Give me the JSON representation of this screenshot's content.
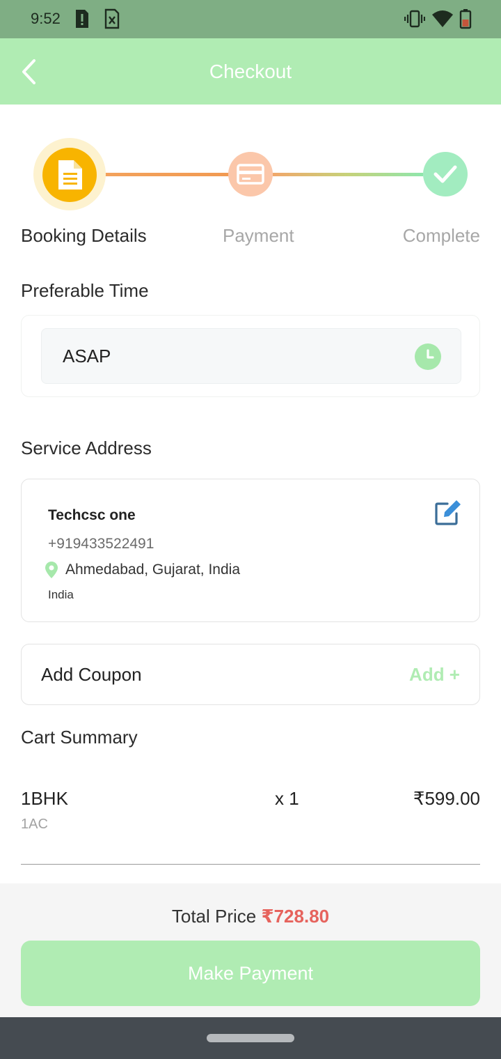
{
  "status_bar": {
    "time": "9:52",
    "icons": [
      "sim-alert-icon",
      "sim-card-icon",
      "vibrate-icon",
      "wifi-icon",
      "battery-icon"
    ]
  },
  "header": {
    "title": "Checkout",
    "back_icon": "chevron-left-icon",
    "background_color": "#b0ecb3"
  },
  "stepper": {
    "steps": [
      {
        "label": "Booking Details",
        "icon": "document-icon",
        "state": "active",
        "color": "#f8b400"
      },
      {
        "label": "Payment",
        "icon": "card-icon",
        "state": "pending",
        "color": "#fbc7aa"
      },
      {
        "label": "Complete",
        "icon": "check-icon",
        "state": "pending",
        "color": "#a2ecc0"
      }
    ]
  },
  "preferable_time": {
    "title": "Preferable Time",
    "value": "ASAP",
    "icon": "clock-icon"
  },
  "service_address": {
    "title": "Service Address",
    "name": "Techcsc one",
    "phone": "+919433522491",
    "address": "Ahmedabad, Gujarat, India",
    "country": "India",
    "edit_icon": "edit-icon"
  },
  "coupon": {
    "label": "Add Coupon",
    "action": "Add +"
  },
  "cart_summary": {
    "title": "Cart Summary",
    "items": [
      {
        "name": "1BHK",
        "variant": "1AC",
        "qty": "x 1",
        "price": "₹599.00"
      }
    ]
  },
  "footer": {
    "total_label": "Total Price",
    "total_amount": "₹728.80",
    "pay_button": "Make Payment",
    "accent_color": "#e6635d"
  }
}
